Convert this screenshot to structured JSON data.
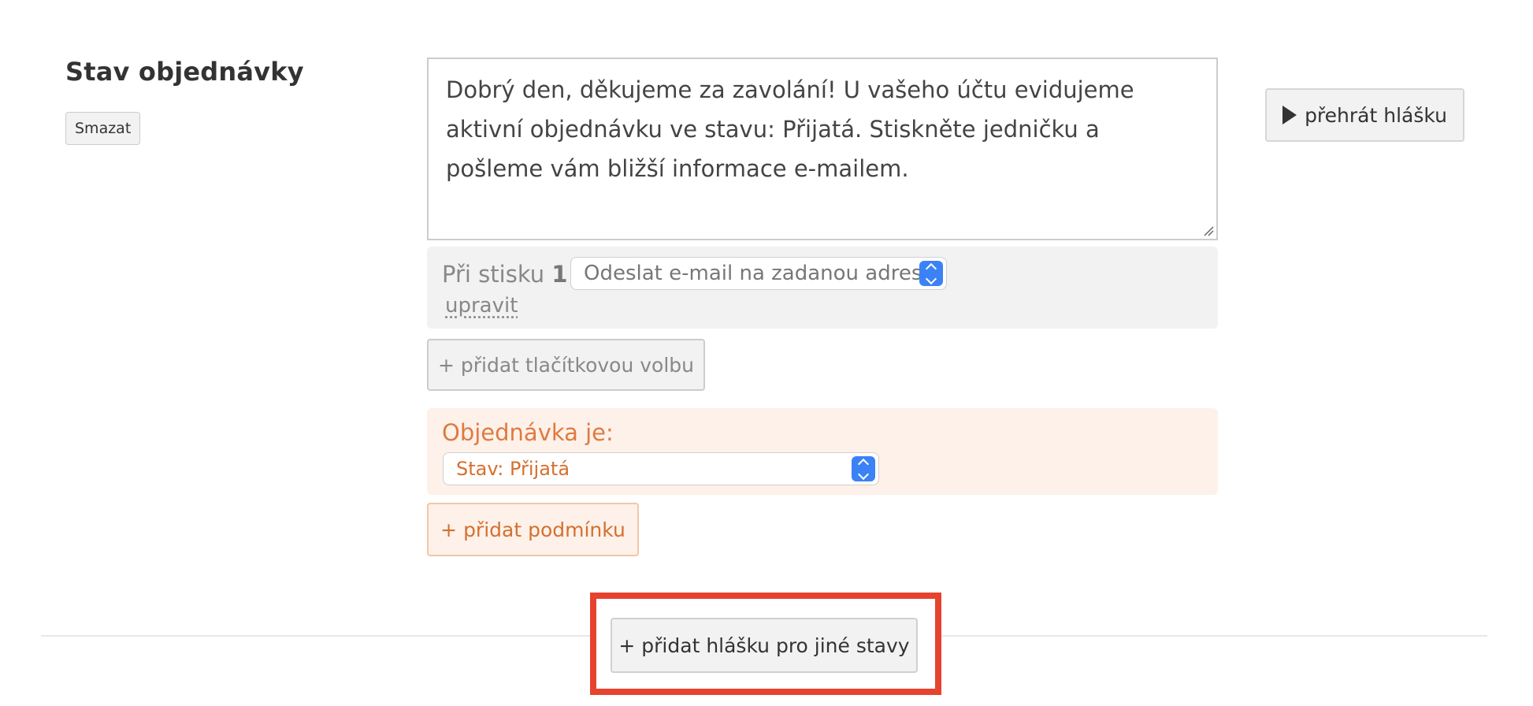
{
  "section": {
    "title": "Stav objednávky",
    "delete_label": "Smazat"
  },
  "message": {
    "text": "Dobrý den, děkujeme za zavolání! U vašeho účtu evidujeme aktivní objednávku ve stavu: Přijatá. Stiskněte jedničku a pošleme vám bližší informace e-mailem."
  },
  "play": {
    "label": "přehrát hlášku",
    "icon": "play-icon"
  },
  "keypress": {
    "prefix": "Při stisku",
    "key": "1",
    "action_selected": "Odeslat e-mail na zadanou adresu",
    "edit_label": "upravit",
    "add_option_label": "+ přidat tlačítkovou volbu"
  },
  "condition": {
    "label": "Objednávka je:",
    "status_selected": "Stav: Přijatá",
    "add_condition_label": "+ přidat podmínku"
  },
  "footer": {
    "add_message_label": "+ přidat hlášku pro jiné stavy"
  },
  "colors": {
    "accent_orange": "#e07a3f",
    "select_blue": "#3b82f6",
    "highlight_red": "#e5432e"
  }
}
